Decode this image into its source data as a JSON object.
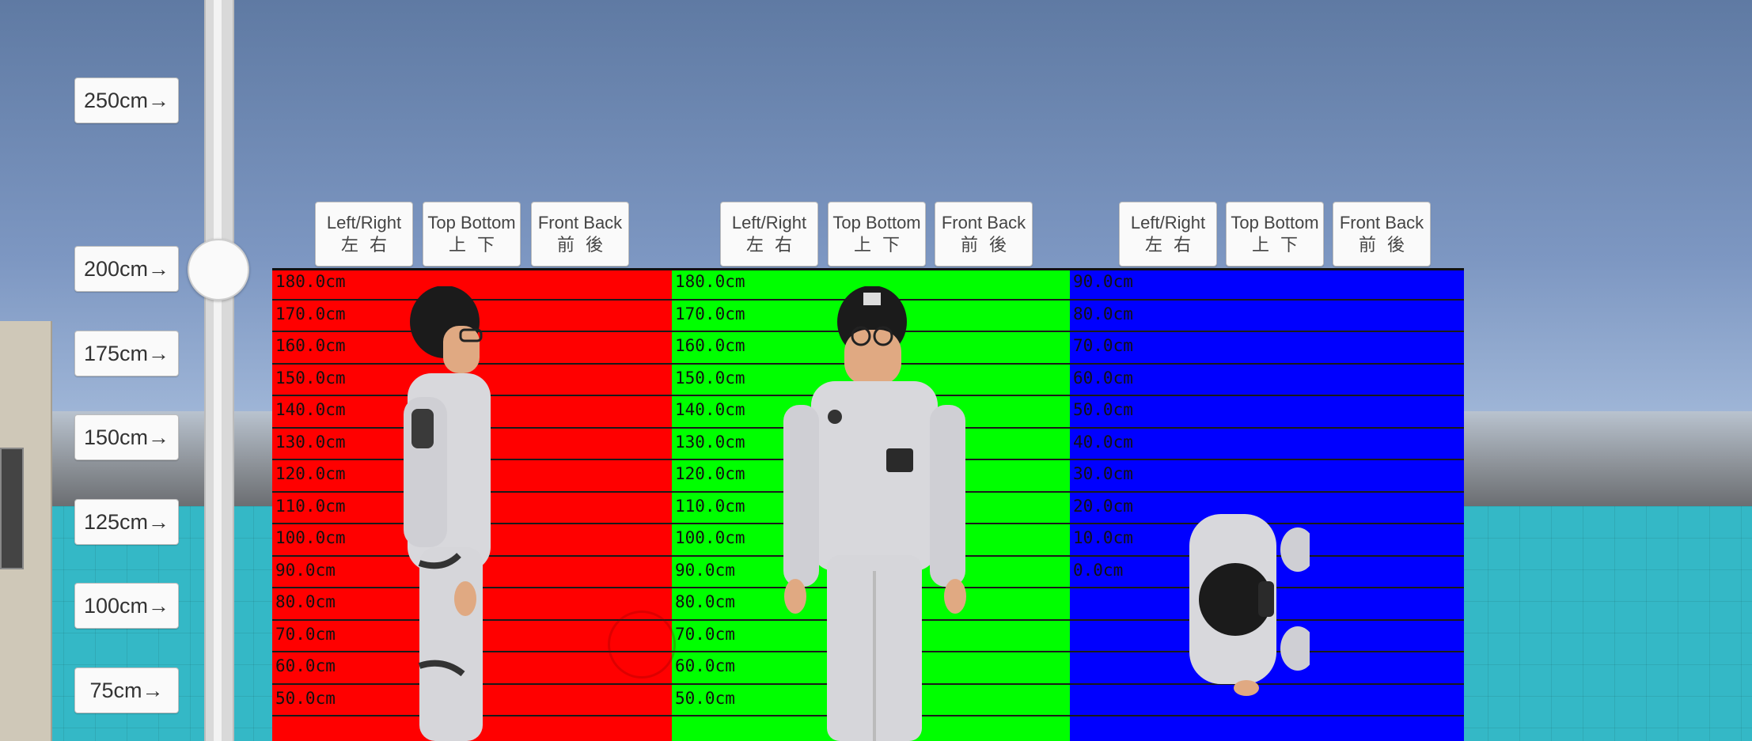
{
  "height_buttons": [
    {
      "label": "250cm→"
    },
    {
      "label": "200cm→"
    },
    {
      "label": "175cm→"
    },
    {
      "label": "150cm→"
    },
    {
      "label": "125cm→"
    },
    {
      "label": "100cm→"
    },
    {
      "label": "75cm→"
    }
  ],
  "view_buttons": {
    "left_right": {
      "en": "Left/Right",
      "jp": "左右"
    },
    "top_bottom": {
      "en": "Top Bottom",
      "jp": "上下"
    },
    "front_back": {
      "en": "Front Back",
      "jp": "前後"
    }
  },
  "boards": {
    "red": {
      "color": "#ff0000",
      "rows": [
        "180.0cm",
        "170.0cm",
        "160.0cm",
        "150.0cm",
        "140.0cm",
        "130.0cm",
        "120.0cm",
        "110.0cm",
        "100.0cm",
        "90.0cm",
        "80.0cm",
        "70.0cm",
        "60.0cm",
        "50.0cm"
      ]
    },
    "green": {
      "color": "#00ff00",
      "rows": [
        "180.0cm",
        "170.0cm",
        "160.0cm",
        "150.0cm",
        "140.0cm",
        "130.0cm",
        "120.0cm",
        "110.0cm",
        "100.0cm",
        "90.0cm",
        "80.0cm",
        "70.0cm",
        "60.0cm",
        "50.0cm"
      ]
    },
    "blue": {
      "color": "#0000ff",
      "rows": [
        "90.0cm",
        "80.0cm",
        "70.0cm",
        "60.0cm",
        "50.0cm",
        "40.0cm",
        "30.0cm",
        "20.0cm",
        "10.0cm",
        "0.0cm",
        "",
        "",
        "",
        ""
      ]
    }
  }
}
